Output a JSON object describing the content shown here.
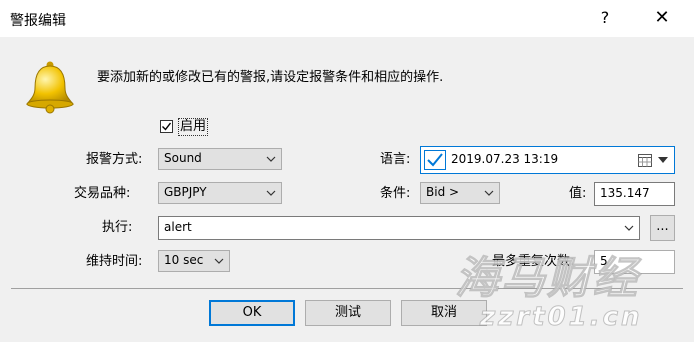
{
  "window": {
    "title": "警报编辑",
    "help_label": "?",
    "close_label": "✕"
  },
  "info_text": "要添加新的或修改已有的警报,请设定报警条件和相应的操作.",
  "enabled": {
    "label": "启用",
    "checked": true
  },
  "alert_type": {
    "label": "报警方式:",
    "value": "Sound"
  },
  "language": {
    "label": "语言:",
    "value": "2019.07.23 13:19"
  },
  "symbol": {
    "label": "交易品种:",
    "value": "GBPJPY"
  },
  "condition": {
    "label": "条件:",
    "value": "Bid >"
  },
  "price": {
    "label": "值:",
    "value": "135.147"
  },
  "action": {
    "label": "执行:",
    "value": "alert",
    "browse_label": "..."
  },
  "duration": {
    "label": "维持时间:",
    "value": "10 sec"
  },
  "repeat": {
    "label": "最多重复次数:",
    "value": "5"
  },
  "buttons": {
    "ok": "OK",
    "test": "测试",
    "cancel": "取消"
  },
  "watermark": {
    "line1": "海马财经",
    "line2": "zzrt01.cn"
  },
  "colors": {
    "accent": "#0078d7",
    "bell": "#f2c200"
  }
}
